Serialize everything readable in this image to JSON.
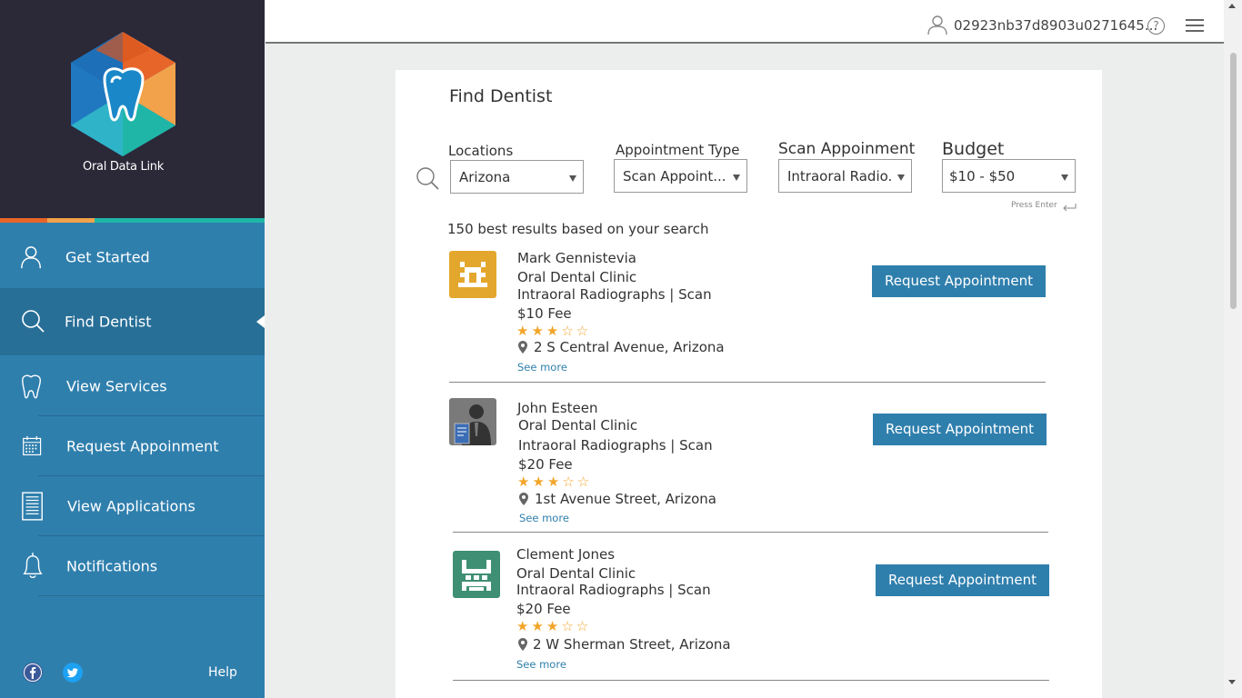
{
  "brand": {
    "name": "Oral Data Link",
    "stripe_colors": [
      "#e8652a",
      "#f2a24a",
      "#1fb6a7"
    ]
  },
  "sidebar": {
    "items": [
      {
        "label": "Get Started",
        "icon": "user-icon"
      },
      {
        "label": "Find Dentist",
        "icon": "search-icon",
        "active": true
      },
      {
        "label": "View Services",
        "icon": "tooth-icon"
      },
      {
        "label": "Request Appoinment",
        "icon": "calendar-icon"
      },
      {
        "label": "View Applications",
        "icon": "document-icon"
      },
      {
        "label": "Notifications",
        "icon": "bell-icon"
      }
    ],
    "footer": {
      "help_label": "Help",
      "social": [
        "facebook-icon",
        "twitter-icon"
      ]
    }
  },
  "topbar": {
    "user_id": "02923nb37d8903u0271645...",
    "help_glyph": "?"
  },
  "main": {
    "title": "Find Dentist",
    "filters": {
      "location": {
        "label": "Locations",
        "value": "Arizona"
      },
      "appointment_type": {
        "label": "Appointment Type",
        "value": "Scan Appoint..."
      },
      "scan_appointment": {
        "label": "Scan Appoinment",
        "value": "Intraoral Radio..."
      },
      "budget": {
        "label": "Budget",
        "value": "$10 - $50"
      }
    },
    "press_enter": "Press Enter",
    "results_count": "150 best results based on your search",
    "results": [
      {
        "name": "Mark Gennistevia",
        "clinic": "Oral Dental Clinic",
        "services": "Intraoral Radiographs | Scan",
        "fee": "$10 Fee",
        "rating": 3,
        "max_rating": 5,
        "stars": "★★★☆☆",
        "address": "2 S Central Avenue, Arizona",
        "see_more": "See more",
        "button": "Request Appointment",
        "avatar_color": "#e4a72d"
      },
      {
        "name": "John Esteen",
        "clinic": "Oral Dental Clinic",
        "services": "Intraoral Radiographs | Scan",
        "fee": "$20 Fee",
        "rating": 3,
        "max_rating": 5,
        "stars": "★★★☆☆",
        "address": "1st Avenue Street, Arizona",
        "see_more": "See more",
        "button": "Request Appointment",
        "avatar_color": "#7a7a7a"
      },
      {
        "name": "Clement Jones",
        "clinic": "Oral Dental Clinic",
        "services": "Intraoral Radiographs | Scan",
        "fee": "$20 Fee",
        "rating": 3,
        "max_rating": 5,
        "stars": "★★★☆☆",
        "address": "2 W Sherman Street, Arizona",
        "see_more": "See more",
        "button": "Request Appointment",
        "avatar_color": "#3e8f73"
      }
    ]
  }
}
